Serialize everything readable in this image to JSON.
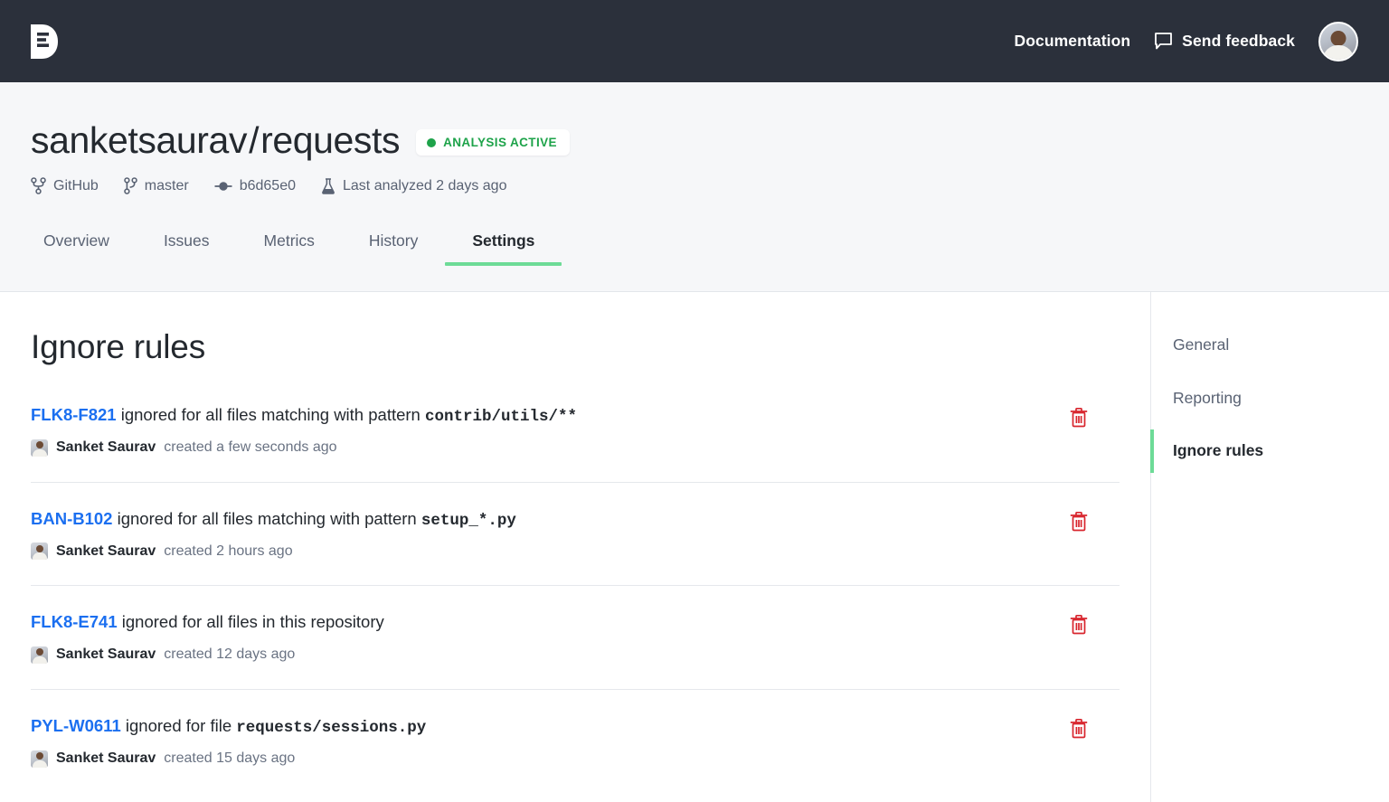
{
  "topnav": {
    "logo_name": "deepsource-logo",
    "documentation_label": "Documentation",
    "feedback_label": "Send feedback",
    "feedback_icon": "speech-bubble-icon",
    "avatar_name": "user-avatar"
  },
  "repo": {
    "owner": "sanketsaurav",
    "separator": "/",
    "name": "requests",
    "status_badge": "ANALYSIS ACTIVE",
    "status_color": "#1ea34a",
    "meta": [
      {
        "icon": "fork-icon",
        "label": "GitHub"
      },
      {
        "icon": "branch-icon",
        "label": "master"
      },
      {
        "icon": "commit-icon",
        "label": "b6d65e0"
      },
      {
        "icon": "flask-icon",
        "label": "Last analyzed 2 days ago"
      }
    ]
  },
  "tabs": [
    {
      "label": "Overview",
      "active": false
    },
    {
      "label": "Issues",
      "active": false
    },
    {
      "label": "Metrics",
      "active": false
    },
    {
      "label": "History",
      "active": false
    },
    {
      "label": "Settings",
      "active": true
    }
  ],
  "main": {
    "heading": "Ignore rules",
    "rules": [
      {
        "code": "FLK8-F821",
        "description": "ignored for all files matching with pattern",
        "pattern": "contrib/utils/**",
        "author": "Sanket Saurav",
        "when": "created a few seconds ago",
        "delete_icon": "trash-icon"
      },
      {
        "code": "BAN-B102",
        "description": "ignored for all files matching with pattern",
        "pattern": "setup_*.py",
        "author": "Sanket Saurav",
        "when": "created 2 hours ago",
        "delete_icon": "trash-icon"
      },
      {
        "code": "FLK8-E741",
        "description": "ignored for all files in this repository",
        "pattern": "",
        "author": "Sanket Saurav",
        "when": "created 12 days ago",
        "delete_icon": "trash-icon"
      },
      {
        "code": "PYL-W0611",
        "description": "ignored for file",
        "pattern": "requests/sessions.py",
        "author": "Sanket Saurav",
        "when": "created 15 days ago",
        "delete_icon": "trash-icon"
      }
    ]
  },
  "settings_nav": [
    {
      "label": "General",
      "active": false
    },
    {
      "label": "Reporting",
      "active": false
    },
    {
      "label": "Ignore rules",
      "active": true
    }
  ],
  "colors": {
    "nav_bg": "#2b303b",
    "header_bg": "#f6f7f9",
    "accent_green": "#6ddb97",
    "link_blue": "#1b6ff0",
    "danger_red": "#d8252d"
  }
}
